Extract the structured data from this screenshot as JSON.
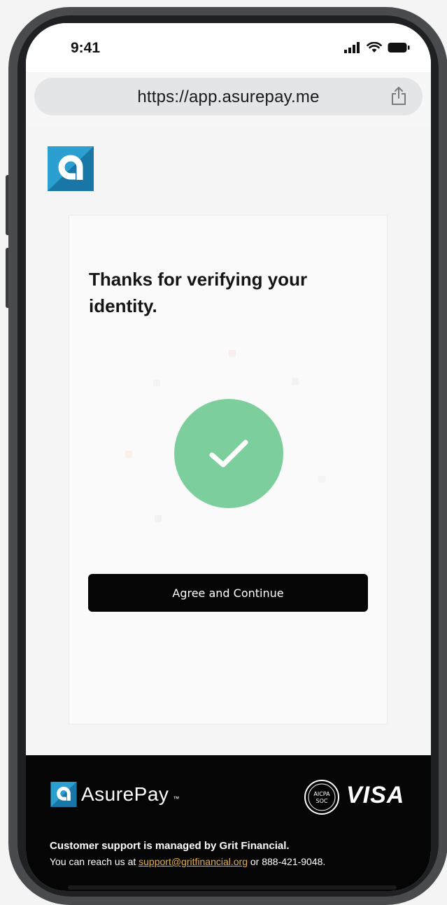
{
  "status_bar": {
    "time": "9:41",
    "icons": [
      "signal-icon",
      "wifi-icon",
      "battery-icon"
    ]
  },
  "browser": {
    "url": "https://app.asurepay.me"
  },
  "card": {
    "title": "Thanks for verifying your identity.",
    "agree_button_label": "Agree and Continue"
  },
  "footer": {
    "brand_name": "AsurePay",
    "brand_tm": "™",
    "soc_badge_line1": "AICPA",
    "soc_badge_line2": "SOC",
    "visa_label": "VISA",
    "support_title": "Customer support is managed by Grit Financial.",
    "support_prefix": "You can reach us at ",
    "support_email": "support@gritfinancial.org",
    "support_suffix": " or 888-421-9048."
  },
  "colors": {
    "success_green": "#7ccf9c",
    "brand_blue": "#1e88b8",
    "button_black": "#050505",
    "link_gold": "#e2b04a"
  }
}
